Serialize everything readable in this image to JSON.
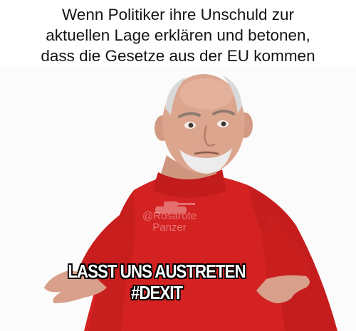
{
  "caption": {
    "line1": "Wenn Politiker ihre Unschuld zur",
    "line2": "aktuellen Lage erklären und betonen,",
    "line3": "dass die Gesetze aus der EU kommen"
  },
  "overlay": {
    "line1": "LASST UNS AUSTRETEN",
    "line2": "#DEXIT"
  },
  "watermark": {
    "handle": "@Rosarote",
    "name": "Panzer"
  },
  "colors": {
    "sweater": "#d42222",
    "skin": "#dca58e",
    "hair": "#d9d9d9",
    "text": "#141414"
  }
}
